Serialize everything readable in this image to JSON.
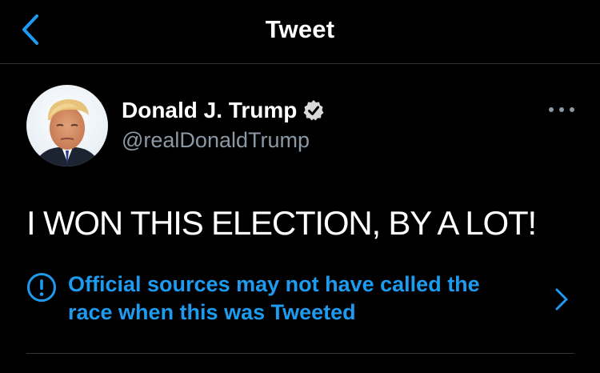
{
  "nav": {
    "title": "Tweet",
    "back_icon": "chevron-left-icon"
  },
  "tweet": {
    "author_name": "Donald J. Trump",
    "handle": "@realDonaldTrump",
    "verified": true,
    "text": "I WON THIS ELECTION, BY A LOT!"
  },
  "notice": {
    "line1": "Official sources may not have called the",
    "line2": "race when this was Tweeted",
    "icon": "info-icon"
  },
  "colors": {
    "background": "#000000",
    "accent": "#1d9bf0",
    "secondary_text": "#8b98a5",
    "divider": "#2f3336"
  }
}
